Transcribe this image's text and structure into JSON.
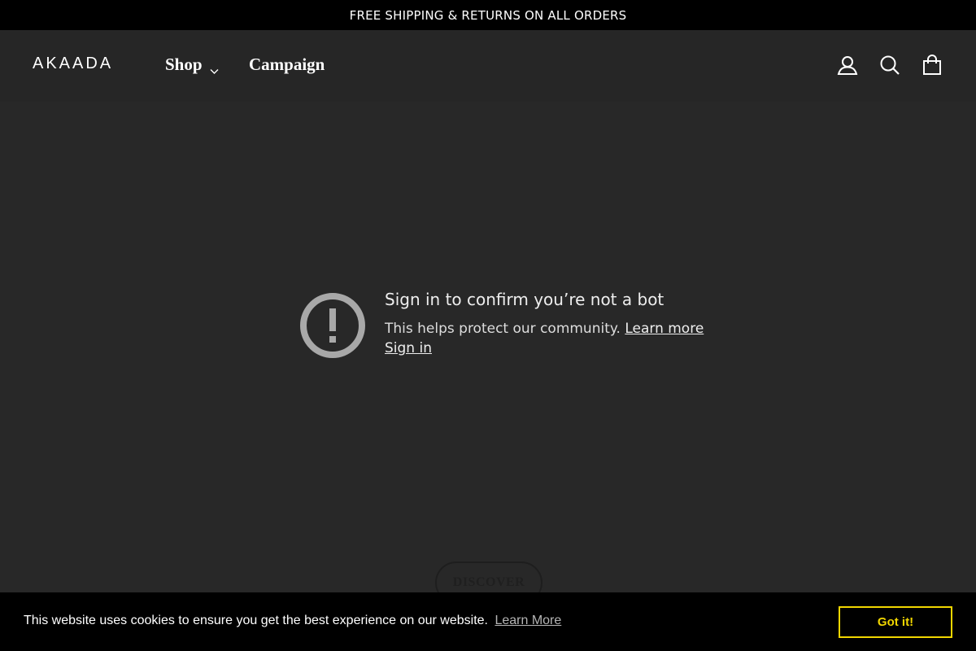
{
  "announcement": {
    "text": "FREE SHIPPING & RETURNS ON ALL ORDERS"
  },
  "header": {
    "logo_text": "AKAADA",
    "nav": {
      "shop_label": "Shop",
      "campaign_label": "Campaign"
    },
    "icons": [
      "account-icon",
      "search-icon",
      "cart-icon"
    ]
  },
  "bot_check": {
    "title": "Sign in to confirm you’re not a bot",
    "body": "This helps protect our community.",
    "learn_more": "Learn more",
    "sign_in": "Sign in",
    "icon": "exclamation-circle-icon"
  },
  "hero": {
    "discover_label": "DISCOVER"
  },
  "cookie_banner": {
    "text": "This website uses cookies to ensure you get the best experience on our website.",
    "learn_more": "Learn More",
    "accept_label": "Got it!",
    "accent_color": "#f1d600"
  },
  "colors": {
    "page_bg": "#282828",
    "announcement_bg": "#000000",
    "cookie_bg": "#000000"
  }
}
